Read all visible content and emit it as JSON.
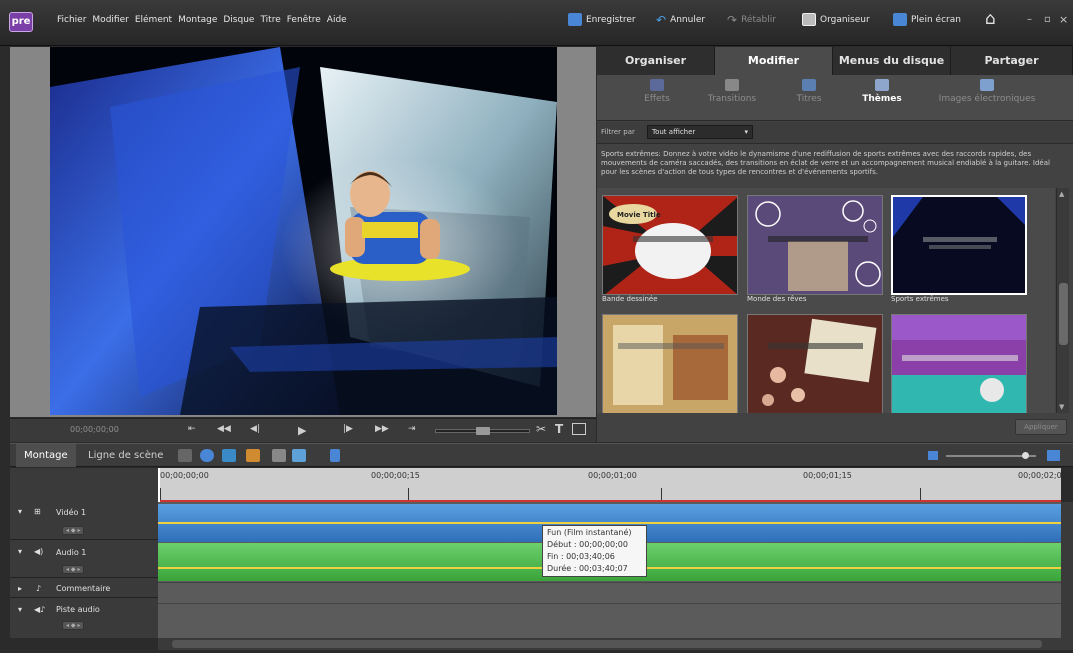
{
  "app": {
    "logo": "pre"
  },
  "menu": [
    "Fichier",
    "Modifier",
    "Elément",
    "Montage",
    "Disque",
    "Titre",
    "Fenêtre",
    "Aide"
  ],
  "toolbar": {
    "save": "Enregistrer",
    "undo": "Annuler",
    "redo": "Rétablir",
    "organizer": "Organiseur",
    "fullscreen": "Plein écran",
    "min": "–",
    "max": "▫",
    "close": "×"
  },
  "monitor": {
    "timecode": "00;00;00;00"
  },
  "panel_tabs": [
    "Organiser",
    "Modifier",
    "Menus du disque",
    "Partager"
  ],
  "sub_tabs": [
    "Effets",
    "Transitions",
    "Titres",
    "Thèmes",
    "Images électroniques"
  ],
  "filter": {
    "label": "Filtrer par",
    "value": "Tout afficher",
    "arrow": "▾"
  },
  "description": "Sports extrêmes: Donnez à votre vidéo le dynamisme d'une rediffusion de sports extrêmes avec des raccords rapides, des mouvements de caméra saccadés, des transitions en éclat de verre et un accompagnement musical endiablé à la guitare. Idéal pour les scènes d'action de tous types de rencontres et d'événements sportifs.",
  "themes": [
    {
      "label": "Bande dessinée"
    },
    {
      "label": "Monde des rêves"
    },
    {
      "label": "Sports extrêmes"
    },
    {
      "label": ""
    },
    {
      "label": ""
    },
    {
      "label": ""
    }
  ],
  "apply_button": "Appliquer",
  "timeline": {
    "tabs": [
      "Montage",
      "Ligne de scène"
    ],
    "ruler": [
      "00;00;00;00",
      "00;00;00;15",
      "00;00;01;00",
      "00;00;01;15",
      "00;00;02;0"
    ],
    "tracks": [
      {
        "name": "Vidéo 1"
      },
      {
        "name": "Audio 1"
      },
      {
        "name": "Commentaire"
      },
      {
        "name": "Piste audio"
      }
    ],
    "tooltip": {
      "title": "Fun (Film instantané)",
      "start": "Début : 00;00;00;00",
      "end": "Fin : 00;03;40;06",
      "duration": "Durée : 00;03;40;07"
    }
  },
  "colors": {
    "accent": "#7b3fa8",
    "video_track": "#3f84c8",
    "audio_track": "#4fbf4f",
    "playhead": "#cc3333"
  }
}
